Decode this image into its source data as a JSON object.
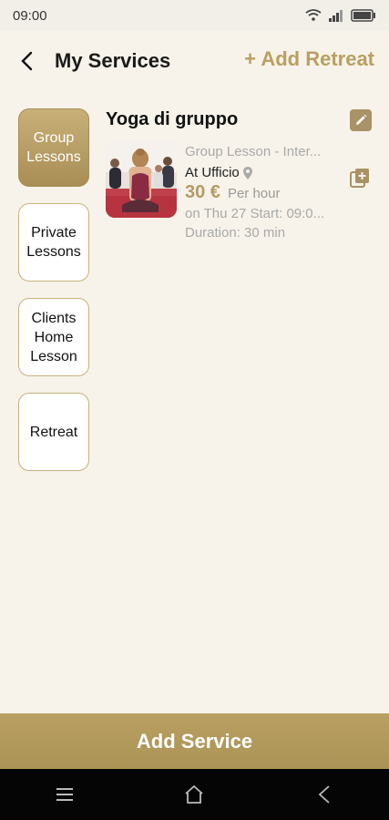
{
  "status": {
    "time": "09:00"
  },
  "header": {
    "title": "My Services",
    "add_retreat": "+ Add Retreat"
  },
  "categories": [
    {
      "label": "Group\nLessons",
      "active": true
    },
    {
      "label": "Private\nLessons",
      "active": false
    },
    {
      "label": "Clients\nHome\nLesson",
      "active": false
    },
    {
      "label": "Retreat",
      "active": false
    }
  ],
  "service": {
    "title": "Yoga di gruppo",
    "subtitle": "Group Lesson - Inter...",
    "location": "At Ufficio",
    "price": "30 €",
    "price_unit": "Per hour",
    "schedule": "on Thu 27 Start: 09:0...",
    "duration": "Duration: 30 min"
  },
  "footer": {
    "add_service": "Add Service"
  },
  "icons": {
    "back": "chevron-left-icon",
    "edit": "pencil-icon",
    "copy": "copy-add-icon",
    "location": "location-pin-icon",
    "nav_menu": "menu-icon",
    "nav_home": "home-icon",
    "nav_back": "back-icon"
  },
  "colors": {
    "accent": "#b9a061",
    "background": "#f7f3ea",
    "active_category": "#b59c63"
  }
}
